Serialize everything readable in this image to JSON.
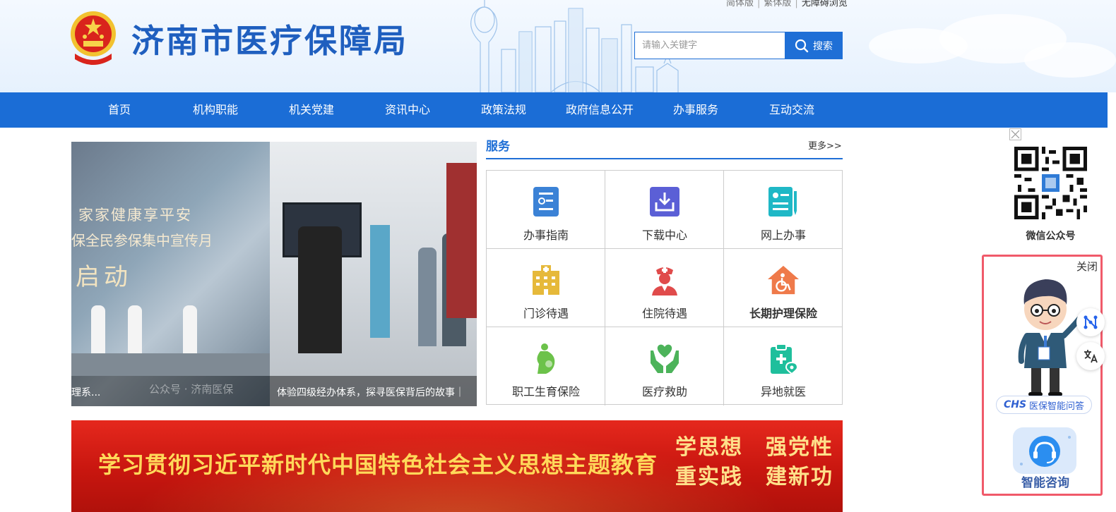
{
  "header": {
    "title": "济南市医疗保障局",
    "version_links": [
      "简体版",
      "繁体版",
      "无障碍浏览"
    ],
    "search_placeholder": "请输入关键字",
    "search_label": "搜索"
  },
  "nav": {
    "items": [
      "首页",
      "机构职能",
      "机关党建",
      "资讯中心",
      "政策法规",
      "政府信息公开",
      "办事服务",
      "互动交流"
    ]
  },
  "carousel": {
    "slide_text": [
      "家家健康享平安",
      "保全民参保集中宣传月",
      "启动"
    ],
    "caption_left": "理系...",
    "watermark": "公众号 · 济南医保",
    "caption_right": "体验四级经办体系，探寻医保背后的故事｜"
  },
  "services": {
    "title": "服务",
    "more": "更多>>",
    "items": [
      {
        "label": "办事指南",
        "icon": "guide-icon",
        "color": "#3b82d6"
      },
      {
        "label": "下载中心",
        "icon": "download-icon",
        "color": "#5b5fd6"
      },
      {
        "label": "网上办事",
        "icon": "online-service-icon",
        "color": "#1fb8c6"
      },
      {
        "label": "门诊待遇",
        "icon": "clinic-icon",
        "color": "#e6b93a"
      },
      {
        "label": "住院待遇",
        "icon": "nurse-icon",
        "color": "#e04b4b"
      },
      {
        "label": "长期护理保险",
        "icon": "wheelchair-icon",
        "color": "#ef7a4a"
      },
      {
        "label": "职工生育保险",
        "icon": "pregnancy-icon",
        "color": "#6cc24a"
      },
      {
        "label": "医疗救助",
        "icon": "heart-hands-icon",
        "color": "#4cb35a"
      },
      {
        "label": "异地就医",
        "icon": "clipboard-location-icon",
        "color": "#1fbf9c"
      }
    ]
  },
  "banner": {
    "main_text": "学习贯彻习近平新时代中国特色社会主义思想主题教育",
    "right_line1": "学思想　强党性",
    "right_line2": "重实践　建新功"
  },
  "side": {
    "qr_label": "微信公众号",
    "assist_close": "关闭",
    "assist_badge_brand": "CHS",
    "assist_badge_text": "医保智能问答",
    "consult_label": "智能咨询"
  },
  "colors": {
    "primary": "#1b6dd6",
    "banner_red": "#c8160f",
    "banner_gold": "#ffd95a",
    "assist_border": "#f05a6a"
  }
}
